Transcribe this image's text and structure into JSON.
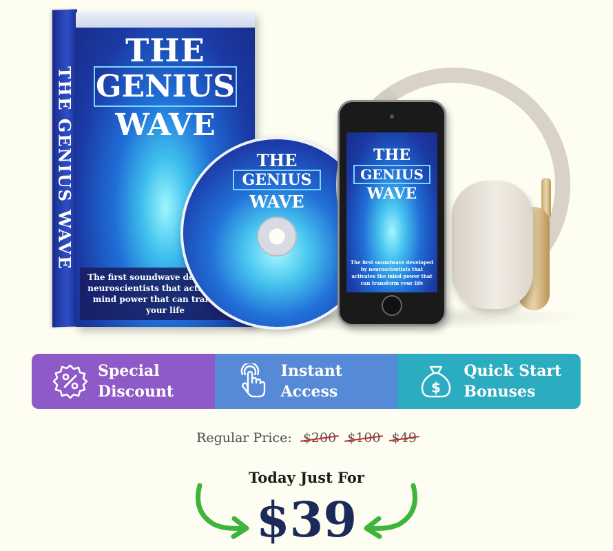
{
  "product": {
    "spine_title": "THE GENIUS WAVE",
    "cover_title_1": "THE",
    "cover_title_2": "GENIUS",
    "cover_title_3": "WAVE",
    "cover_tagline": "The first soundwave developed by neuroscientists that activates the mind power that can transform your life",
    "disc_title_1": "THE",
    "disc_title_2": "GENIUS",
    "disc_title_3": "WAVE",
    "phone_title_1": "THE",
    "phone_title_2": "GENIUS",
    "phone_title_3": "WAVE",
    "phone_tagline": "The first soundwave developed by neuroscientists that activates the mind power that can transform your life"
  },
  "features": [
    {
      "icon": "percent-badge-icon",
      "line1": "Special",
      "line2": "Discount",
      "color": "#8e5ac8"
    },
    {
      "icon": "tap-hand-icon",
      "line1": "Instant",
      "line2": "Access",
      "color": "#568ad6"
    },
    {
      "icon": "money-bag-icon",
      "line1": "Quick Start",
      "line2": "Bonuses",
      "color": "#2bacc0"
    }
  ],
  "pricing": {
    "regular_label": "Regular Price:",
    "old_prices": [
      "$200",
      "$100",
      "$49"
    ],
    "today_label": "Today Just For",
    "price": "$39",
    "arrow_color": "#3cb53a",
    "strike_color": "#d0261f",
    "price_color": "#1c2a5a"
  }
}
